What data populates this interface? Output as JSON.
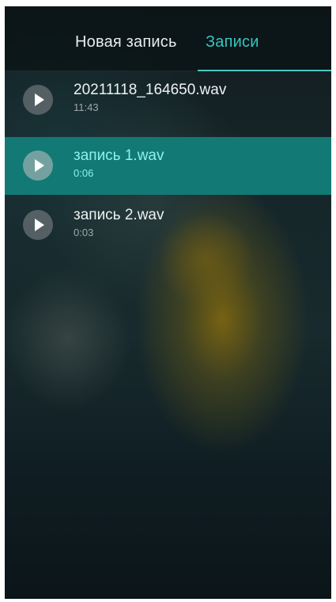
{
  "tabs": {
    "new_recording": "Новая запись",
    "recordings": "Записи",
    "active": "recordings"
  },
  "recordings": [
    {
      "name": "20211118_164650.wav",
      "duration": "11:43",
      "selected": false
    },
    {
      "name": "запись 1.wav",
      "duration": "0:06",
      "selected": true
    },
    {
      "name": "запись 2.wav",
      "duration": "0:03",
      "selected": false
    }
  ],
  "icons": {
    "play": "play-icon"
  },
  "colors": {
    "accent": "#37c6c2",
    "selected_row": "#137974",
    "selected_text": "#8ff1ea"
  }
}
